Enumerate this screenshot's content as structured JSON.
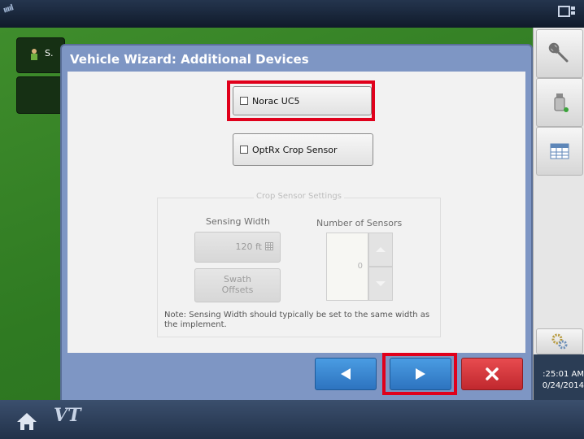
{
  "background": {
    "tab_label": "S.",
    "time": ":25:01 AM",
    "date": "0/24/2014",
    "vt_label": "VT"
  },
  "dialog": {
    "title": "Vehicle Wizard:  Additional Devices",
    "norac_label": "Norac UC5",
    "optrx_label": "OptRx Crop Sensor",
    "norac_checked": false,
    "optrx_checked": false,
    "settings": {
      "legend": "Crop Sensor Settings",
      "sensing_width_label": "Sensing Width",
      "sensing_width_value": "120 ft",
      "number_of_sensors_label": "Number of Sensors",
      "number_of_sensors_value": "0",
      "swath_offsets_label": "Swath\nOffsets",
      "note": "Note: Sensing Width should typically be set to the same width as the implement."
    }
  },
  "colors": {
    "dialog_bg": "#7e96c4",
    "highlight": "#e0001b",
    "nav_blue": "#2d73bf",
    "nav_red": "#c0282e"
  },
  "icons": {
    "back": "left-triangle",
    "next": "right-triangle",
    "cancel": "x-mark",
    "home": "house",
    "wrench": "wrench",
    "bottle": "bottle",
    "calendar": "calendar-grid",
    "settings": "gears"
  }
}
